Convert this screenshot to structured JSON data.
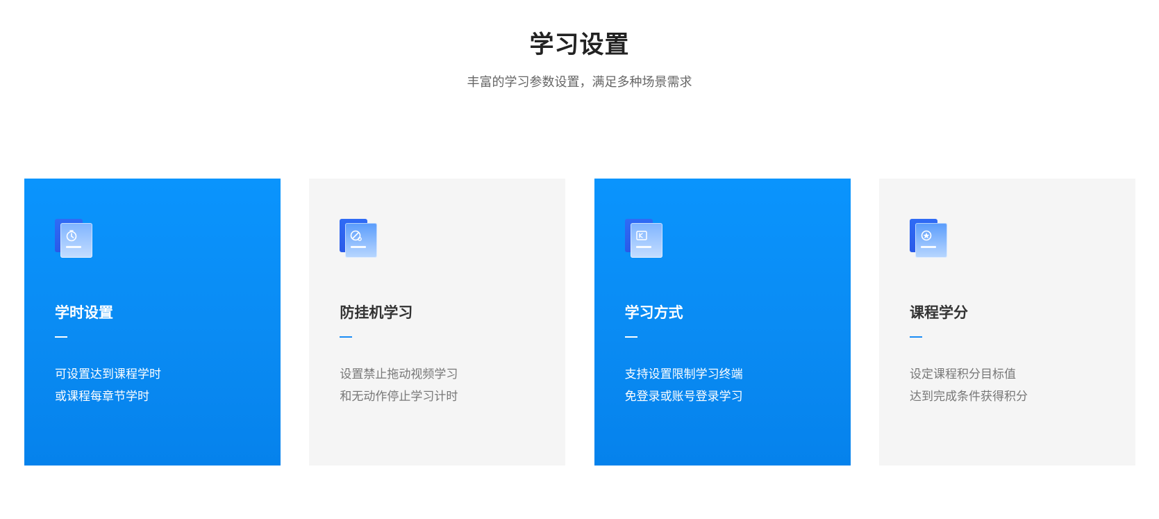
{
  "section": {
    "title": "学习设置",
    "subtitle": "丰富的学习参数设置，满足多种场景需求"
  },
  "colors": {
    "card_blue": "#0a8bf3",
    "card_grey": "#f5f5f5",
    "accent": "#1a8cf5"
  },
  "cards": [
    {
      "icon": "timer-icon",
      "title": "学时设置",
      "lines": [
        "可设置达到课程学时",
        "或课程每章节学时"
      ]
    },
    {
      "icon": "anti-idle-icon",
      "title": "防挂机学习",
      "lines": [
        "设置禁止拖动视频学习",
        "和无动作停止学习计时"
      ]
    },
    {
      "icon": "login-terminal-icon",
      "title": "学习方式",
      "lines": [
        "支持设置限制学习终端",
        "免登录或账号登录学习"
      ]
    },
    {
      "icon": "credit-star-icon",
      "title": "课程学分",
      "lines": [
        "设定课程积分目标值",
        "达到完成条件获得积分"
      ]
    }
  ]
}
